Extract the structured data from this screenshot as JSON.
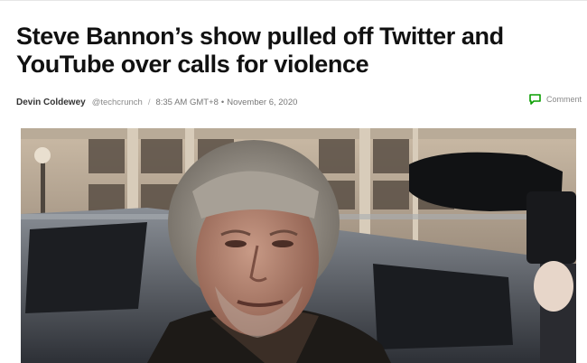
{
  "article": {
    "headline": "Steve Bannon’s show pulled off Twitter and YouTube over calls for violence",
    "author": "Devin Coldewey",
    "handle": "@techcrunch",
    "separator": "/",
    "time": "8:35 AM GMT+8",
    "bullet": "•",
    "date": "November 6, 2020"
  },
  "comment": {
    "label": "Comment",
    "icon": "speech-bubble-icon",
    "accent": "#0a9e01"
  },
  "hero_image": {
    "subject": "photo-of-steve-bannon"
  }
}
